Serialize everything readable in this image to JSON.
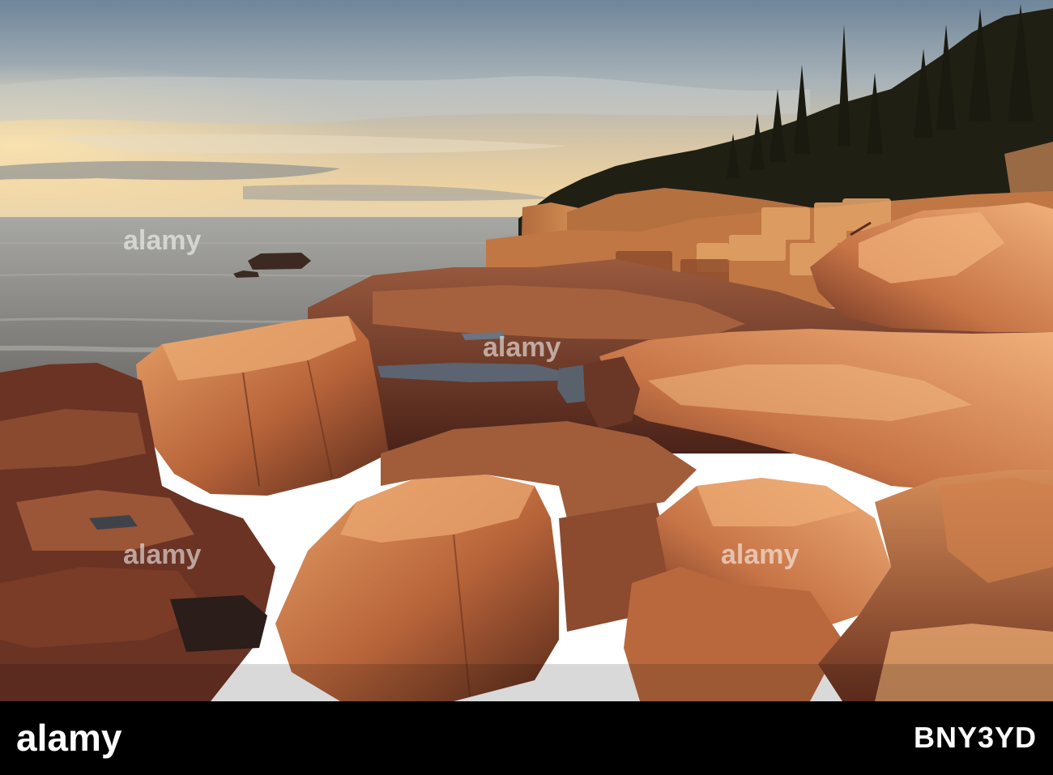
{
  "watermark": {
    "text": "alamy"
  },
  "footer": {
    "brand": "alamy",
    "image_code": "BNY3YD"
  },
  "colors": {
    "sky_top": "#7f93a6",
    "sky_glow": "#e2c79c",
    "sea": "#8c8a86",
    "forest": "#1e1d12",
    "rock_lit": "#d78a4e",
    "rock_shadow": "#4a2418",
    "footer_bg": "#000000",
    "footer_text": "#ffffff"
  }
}
